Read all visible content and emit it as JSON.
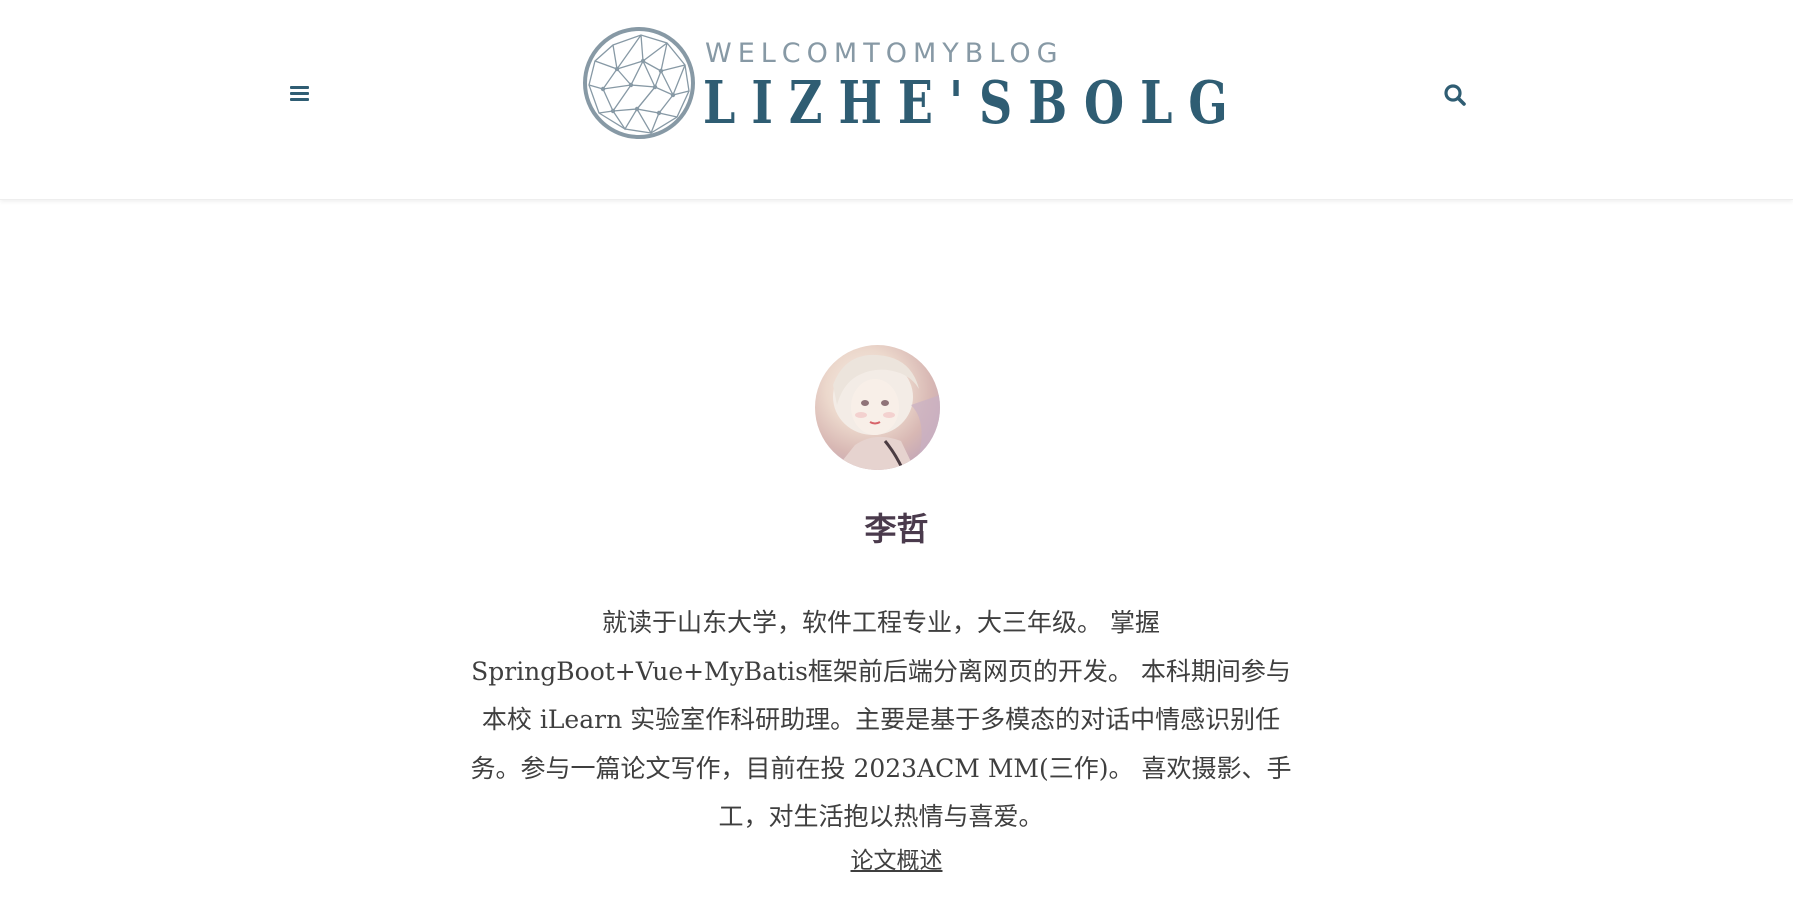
{
  "header": {
    "logo": {
      "subtitle": "WELCOMTOMYBLOG",
      "title": "LIZHE'SBOLG"
    },
    "menu_icon": "hamburger-menu-icon",
    "search_icon": "search-icon"
  },
  "profile": {
    "name": "李哲",
    "bio_lines": [
      "就读于山东大学，软件工程专业，大三年级。 掌握",
      "SpringBoot+Vue+MyBatis框架前后端分离网页的开发。 本科期间参与",
      "本校 iLearn 实验室作科研助理。主要是基于多模态的对话中情感识别任",
      "务。参与一篇论文写作，目前在投 2023ACM MM(三作)。 喜欢摄影、手",
      "工，对生活抱以热情与喜爱。"
    ],
    "link_label": "论文概述"
  },
  "colors": {
    "accent": "#2f5d73",
    "logo_subtitle": "#8799a5",
    "name": "#4a3a4c",
    "text": "#3f3f3f"
  }
}
